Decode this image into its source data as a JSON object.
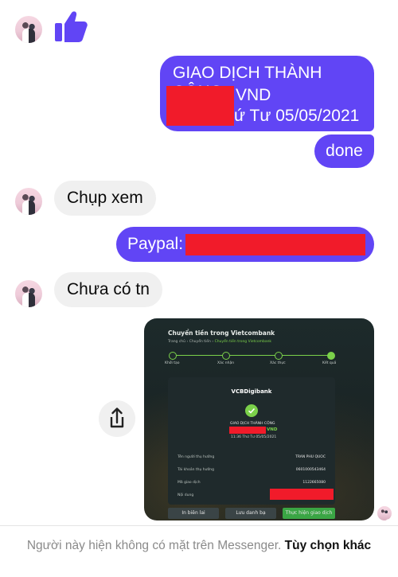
{
  "messages": {
    "like_icon": "thumbs-up-icon",
    "out1": {
      "line1": "GIAO DỊCH THÀNH CÔNG",
      "line2_visible": "VND",
      "line3_visible": "ứ Tư 05/05/2021"
    },
    "out2": "done",
    "in1": "Chụp xem",
    "out3_label": "Paypal:",
    "in2": "Chưa có tn"
  },
  "bank": {
    "title": "Chuyển tiền trong Vietcombank",
    "breadcrumb": [
      "Trang chủ",
      "Chuyển tiền",
      "Chuyển tiền trong Vietcombank"
    ],
    "steps": [
      {
        "num": "1",
        "label": "Khởi tạo"
      },
      {
        "num": "2",
        "label": "Xác nhận"
      },
      {
        "num": "3",
        "label": "Xác thực"
      },
      {
        "num": "4",
        "label": "Kết quả"
      }
    ],
    "logo": "VCBDigibank",
    "status": "GIAO DỊCH THÀNH CÔNG",
    "amount_suffix": "VND",
    "time": "11:36 Thứ Tư 05/05/2021",
    "rows": [
      {
        "label": "Tên người thụ hưởng",
        "value": "TRAN PHU QUOC"
      },
      {
        "label": "Tài khoản thụ hưởng",
        "value": "0601000543464"
      },
      {
        "label": "Mã giao dịch",
        "value": "1122665080"
      },
      {
        "label": "Nội dung",
        "value": ""
      }
    ],
    "buttons": [
      "In biên lai",
      "Lưu danh bạ",
      "Thực hiện giao dịch mới"
    ],
    "colors": {
      "accent": "#7bd14a",
      "button_green": "#3aa544"
    }
  },
  "footer": {
    "notice": "Người này hiện không có mặt trên Messenger.",
    "action": "Tùy chọn khác"
  },
  "colors": {
    "outgoing": "#6145f5",
    "incoming": "#f0f0f0",
    "redaction": "#f11b2a"
  }
}
